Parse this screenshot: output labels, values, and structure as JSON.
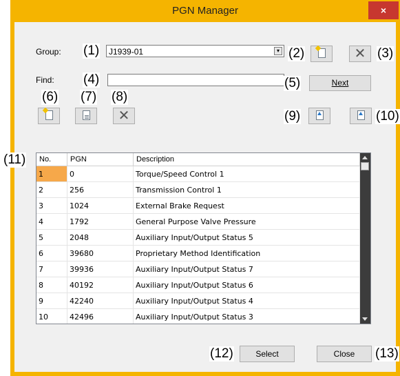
{
  "window": {
    "title": "PGN Manager",
    "close_glyph": "×"
  },
  "labels": {
    "group": "Group:",
    "find": "Find:"
  },
  "group_select": {
    "value": "J1939-01"
  },
  "find_input": {
    "value": ""
  },
  "buttons": {
    "next": "Next",
    "select": "Select",
    "close": "Close"
  },
  "callouts": {
    "c1": "(1)",
    "c2": "(2)",
    "c3": "(3)",
    "c4": "(4)",
    "c5": "(5)",
    "c6": "(6)",
    "c7": "(7)",
    "c8": "(8)",
    "c9": "(9)",
    "c10": "(10)",
    "c11": "(11)",
    "c12": "(12)",
    "c13": "(13)"
  },
  "icons": {
    "new_group": "new-document-icon",
    "delete_group": "delete-x-icon",
    "new_pgn": "new-document-icon",
    "edit_pgn": "edit-properties-icon",
    "delete_pgn": "delete-x-icon",
    "import": "import-icon",
    "export": "export-icon",
    "x_glyph": "✕"
  },
  "table": {
    "columns": [
      "No.",
      "PGN",
      "Description"
    ],
    "rows": [
      [
        "1",
        "0",
        "Torque/Speed Control 1"
      ],
      [
        "2",
        "256",
        "Transmission Control 1"
      ],
      [
        "3",
        "1024",
        "External Brake Request"
      ],
      [
        "4",
        "1792",
        "General Purpose Valve Pressure"
      ],
      [
        "5",
        "2048",
        "Auxiliary Input/Output Status 5"
      ],
      [
        "6",
        "39680",
        "Proprietary Method Identification"
      ],
      [
        "7",
        "39936",
        "Auxiliary Input/Output Status 7"
      ],
      [
        "8",
        "40192",
        "Auxiliary Input/Output Status 6"
      ],
      [
        "9",
        "42240",
        "Auxiliary Input/Output Status 4"
      ],
      [
        "10",
        "42496",
        "Auxiliary Input/Output Status 3"
      ]
    ],
    "selected_cell": "row 1, No."
  },
  "colors": {
    "frame": "#f5b400",
    "close_button": "#c7372f",
    "selection": "#f6a84a",
    "scrollbar": "#3c3c3c"
  }
}
